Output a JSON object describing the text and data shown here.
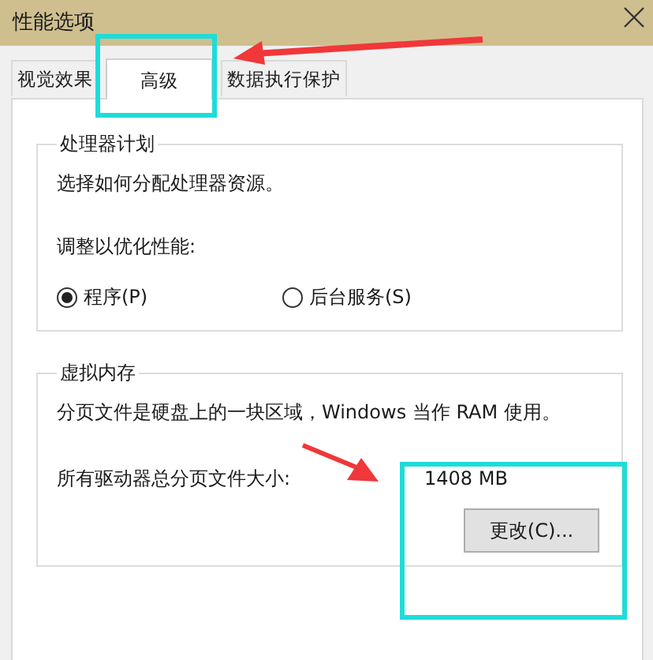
{
  "window": {
    "title": "性能选项"
  },
  "tabs": [
    {
      "label": "视觉效果",
      "selected": false
    },
    {
      "label": "高级",
      "selected": true
    },
    {
      "label": "数据执行保护",
      "selected": false
    }
  ],
  "processor_scheduling": {
    "title": "处理器计划",
    "description": "选择如何分配处理器资源。",
    "prompt": "调整以优化性能:",
    "options": [
      {
        "label": "程序(P)",
        "selected": true
      },
      {
        "label": "后台服务(S)",
        "selected": false
      }
    ]
  },
  "virtual_memory": {
    "title": "虚拟内存",
    "description": "分页文件是硬盘上的一块区域，Windows 当作 RAM 使用。",
    "total_label": "所有驱动器总分页文件大小:",
    "total_value": "1408 MB",
    "button": "更改(C)..."
  }
}
